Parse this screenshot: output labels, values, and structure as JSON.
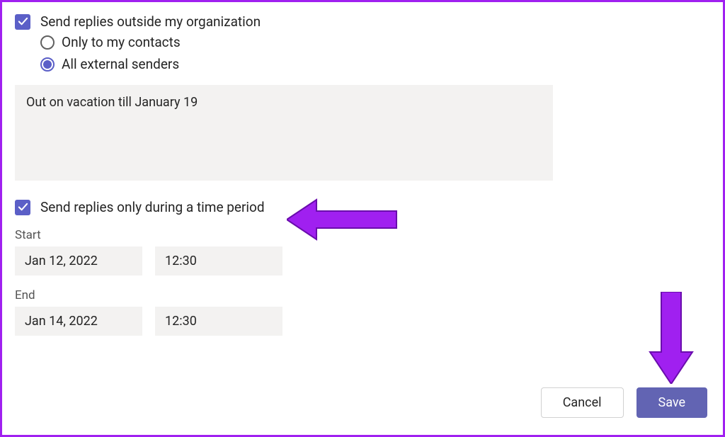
{
  "settings": {
    "sendOutsideLabel": "Send replies outside my organization",
    "radioContacts": "Only to my contacts",
    "radioAll": "All external senders",
    "messageValue": "Out on vacation till January 19",
    "timePeriodLabel": "Send replies only during a time period",
    "startLabel": "Start",
    "endLabel": "End",
    "startDate": "Jan 12, 2022",
    "startTime": "12:30",
    "endDate": "Jan 14, 2022",
    "endTime": "12:30"
  },
  "buttons": {
    "cancel": "Cancel",
    "save": "Save"
  },
  "colors": {
    "accent": "#5b5fc7",
    "annotation": "#a020f0"
  }
}
